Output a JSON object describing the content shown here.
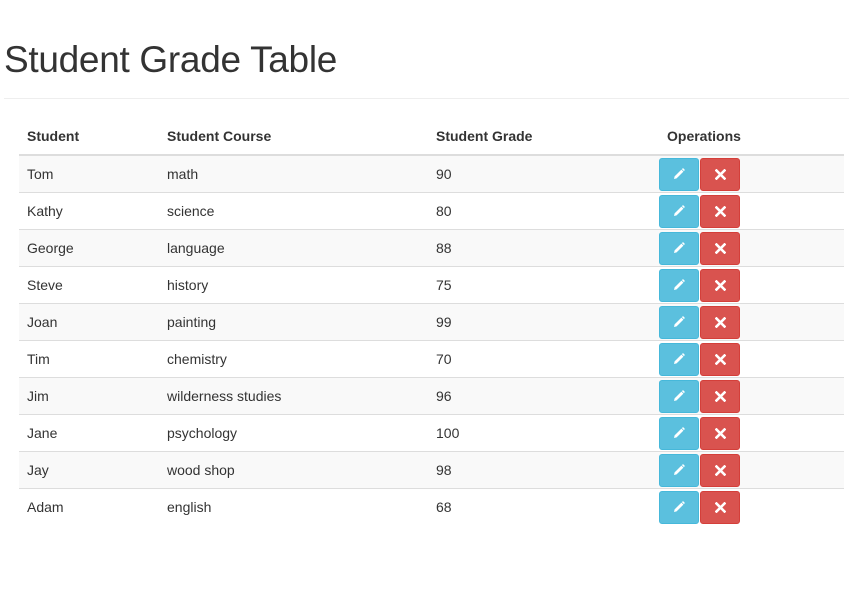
{
  "page": {
    "title": "Student Grade Table"
  },
  "table": {
    "headers": {
      "student": "Student",
      "course": "Student Course",
      "grade": "Student Grade",
      "operations": "Operations"
    },
    "rows": [
      {
        "student": "Tom",
        "course": "math",
        "grade": "90"
      },
      {
        "student": "Kathy",
        "course": "science",
        "grade": "80"
      },
      {
        "student": "George",
        "course": "language",
        "grade": "88"
      },
      {
        "student": "Steve",
        "course": "history",
        "grade": "75"
      },
      {
        "student": "Joan",
        "course": "painting",
        "grade": "99"
      },
      {
        "student": "Tim",
        "course": "chemistry",
        "grade": "70"
      },
      {
        "student": "Jim",
        "course": "wilderness studies",
        "grade": "96"
      },
      {
        "student": "Jane",
        "course": "psychology",
        "grade": "100"
      },
      {
        "student": "Jay",
        "course": "wood shop",
        "grade": "98"
      },
      {
        "student": "Adam",
        "course": "english",
        "grade": "68"
      }
    ]
  },
  "icons": {
    "edit": "pencil-icon",
    "delete": "remove-icon"
  },
  "colors": {
    "edit_button": "#5bc0de",
    "delete_button": "#d9534f",
    "striped_row": "#f9f9f9"
  }
}
